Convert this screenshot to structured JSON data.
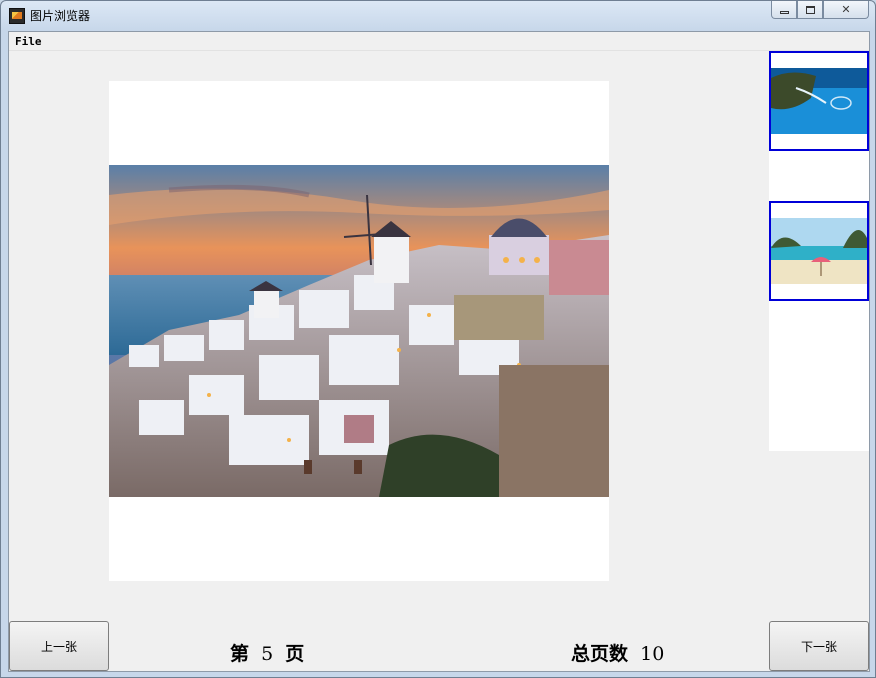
{
  "window": {
    "title": "图片浏览器",
    "controls": [
      "minimize-icon",
      "maximize-icon",
      "close-icon"
    ]
  },
  "menu": {
    "file_label": "File"
  },
  "viewer": {
    "current_image": "santorini-sunset",
    "thumbnails": [
      {
        "name": "island-lagoon"
      },
      {
        "name": "beach-umbrella"
      }
    ]
  },
  "footer": {
    "prev_label": "上一张",
    "next_label": "下一张",
    "page_prefix": "第",
    "page_number": "5",
    "page_suffix": "页",
    "total_label": "总页数",
    "total_pages": "10"
  },
  "colors": {
    "thumb_border": "#0000d8",
    "client_bg": "#f0f0f0"
  }
}
